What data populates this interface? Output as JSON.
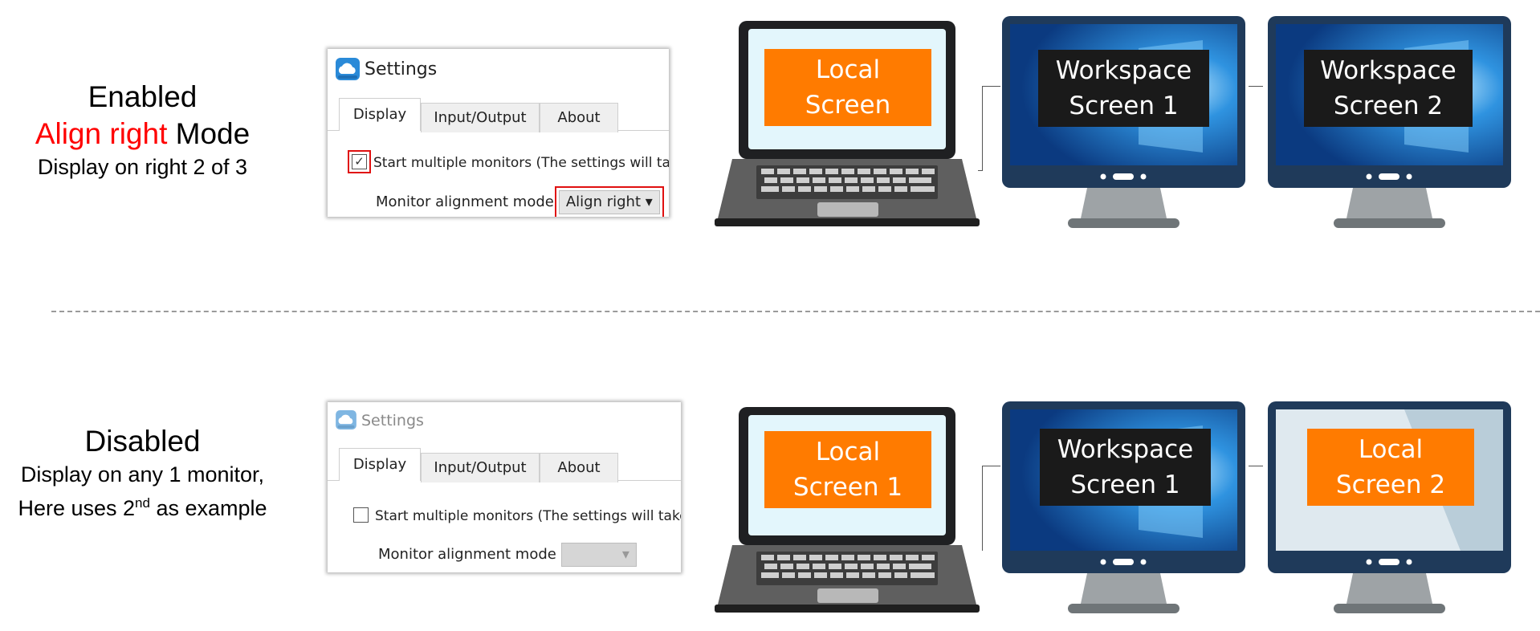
{
  "rows": [
    {
      "caption": {
        "title": "Enabled",
        "mode_highlight": "Align right",
        "mode_rest": " Mode",
        "desc": "Display on right 2 of 3"
      },
      "settings": {
        "title": "Settings",
        "tabs": [
          "Display",
          "Input/Output",
          "About"
        ],
        "active_tab": "Display",
        "checkbox_label": "Start multiple monitors (The settings will take effect after reconnecting)",
        "checkbox_checked": true,
        "alignment_label": "Monitor alignment mode",
        "alignment_value": "Align right"
      },
      "screens": {
        "laptop": [
          "Local",
          "Screen"
        ],
        "monitor1": [
          "Workspace",
          "Screen 1"
        ],
        "monitor2": [
          "Workspace",
          "Screen 2"
        ]
      }
    },
    {
      "caption": {
        "title": "Disabled",
        "desc_line1": "Display on any 1 monitor,",
        "desc_line2_a": "Here uses 2",
        "desc_line2_sup": "nd",
        "desc_line2_b": " as example"
      },
      "settings": {
        "title": "Settings",
        "tabs": [
          "Display",
          "Input/Output",
          "About"
        ],
        "active_tab": "Display",
        "checkbox_label": "Start multiple monitors (The settings will take effect after reconnecting)",
        "checkbox_checked": false,
        "alignment_label": "Monitor alignment mode",
        "alignment_value": ""
      },
      "screens": {
        "laptop": [
          "Local",
          "Screen 1"
        ],
        "monitor1": [
          "Workspace",
          "Screen 1"
        ],
        "monitor2": [
          "Local",
          "Screen 2"
        ]
      }
    }
  ],
  "colors": {
    "accent_red": "#ff0000",
    "label_orange": "#ff7b00",
    "label_black": "#1a1a1a",
    "monitor_frame": "#1f3a5a"
  }
}
